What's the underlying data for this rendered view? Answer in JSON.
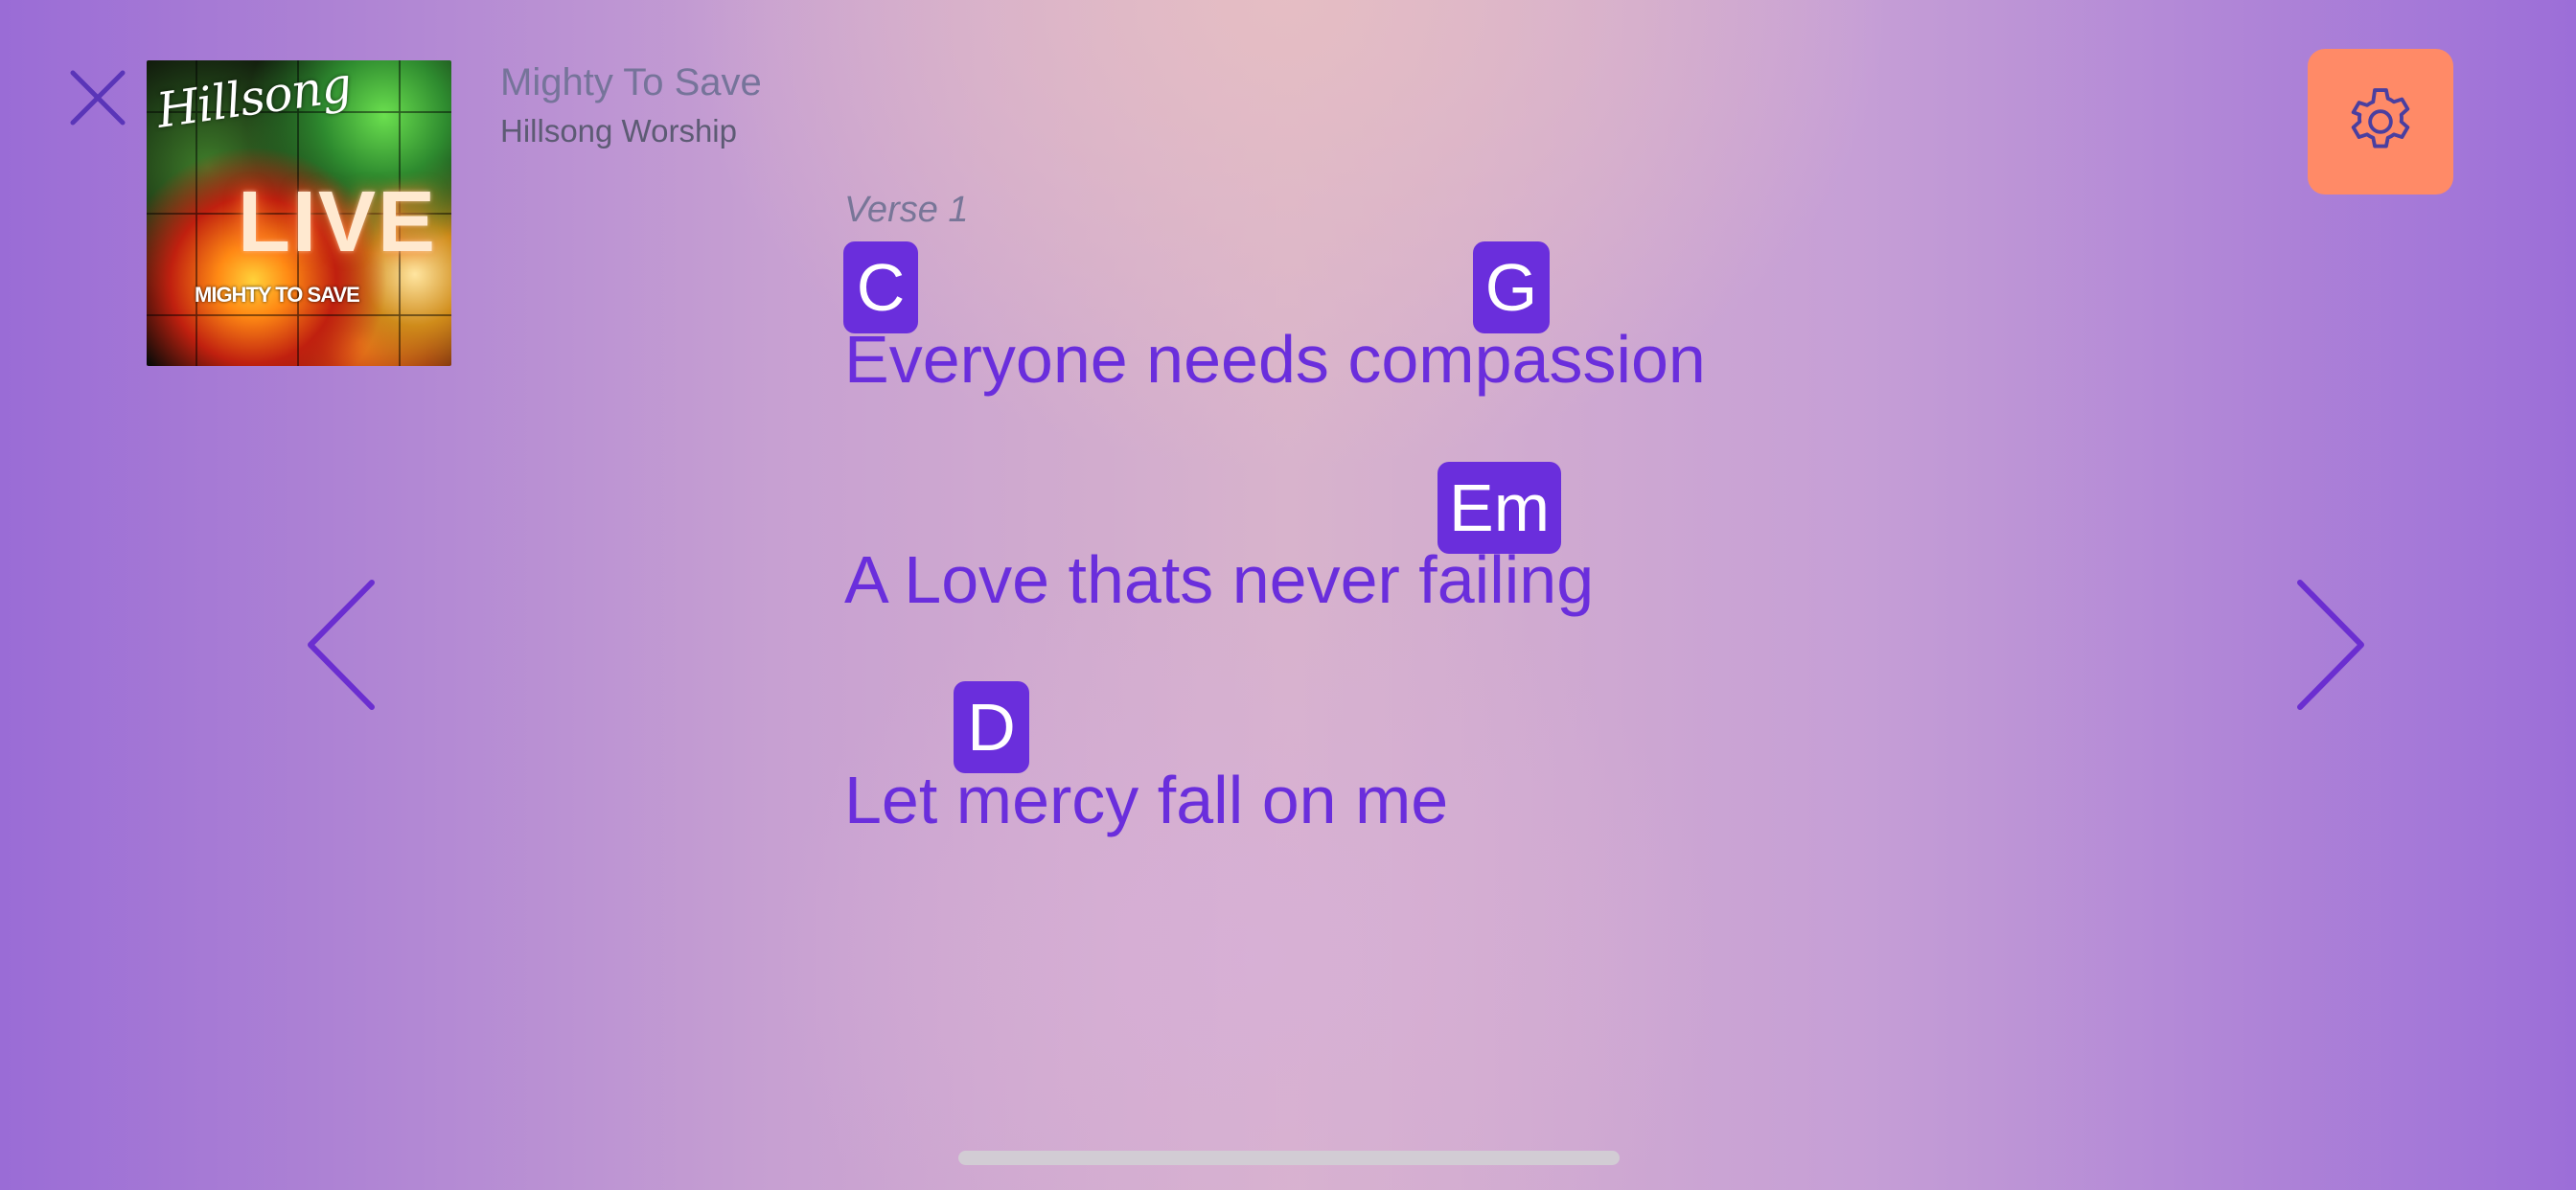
{
  "header": {
    "song_title": "Mighty To Save",
    "artist": "Hillsong Worship"
  },
  "album_art": {
    "brand": "Hillsong",
    "live_text": "LIVE",
    "album_name": "MIGHTY TO SAVE"
  },
  "colors": {
    "accent": "#6a2edc",
    "settings_bg": "#ff8a67",
    "settings_icon": "#4a3fa0",
    "nav_arrow": "#6b2ed0"
  },
  "icons": {
    "close": "close-icon",
    "settings": "gear-icon",
    "previous": "chevron-left-icon",
    "next": "chevron-right-icon"
  },
  "section": {
    "label": "Verse 1",
    "lines": [
      {
        "lyric": "Everyone needs compassion",
        "chords": [
          "C",
          "G"
        ]
      },
      {
        "lyric": "A Love thats never failing",
        "chords": [
          "Em"
        ]
      },
      {
        "lyric": "Let mercy fall on me",
        "chords": [
          "D"
        ]
      }
    ]
  }
}
